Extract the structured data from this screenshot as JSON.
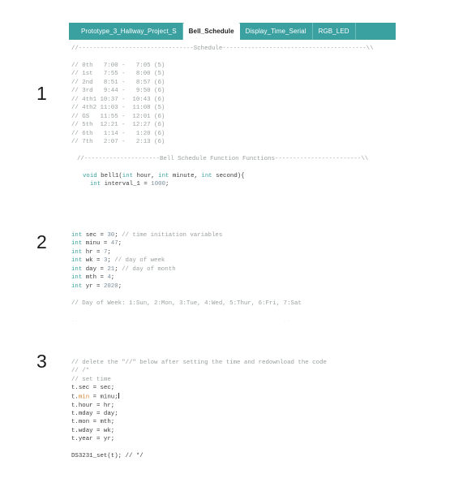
{
  "markers": {
    "one": "1",
    "two": "2",
    "three": "3"
  },
  "colors": {
    "tab_bar_teal": "#3aa0a0",
    "active_tab_bg": "#ffffff",
    "keyword_teal": "#3aa0a0",
    "keyword_orange": "#d4812a",
    "comment_gray": "#9aa0a0",
    "code_text": "#3c3c3c"
  },
  "editor": {
    "tabs": [
      {
        "label": "Prototype_3_Hallway_Project_S",
        "active": false
      },
      {
        "label": "Bell_Schedule",
        "active": true
      },
      {
        "label": "Display_Time_Serial",
        "active": false
      },
      {
        "label": "RGB_LED",
        "active": false
      }
    ]
  },
  "code": {
    "schedule_header": "//--------------------------------Schedule----------------------------------------\\\\",
    "schedule_rows": [
      "// 0th   7:00 -   7:05 (5)",
      "// 1st   7:55 -   8:00 (5)",
      "// 2nd   8:51 -   8:57 (6)",
      "// 3rd   9:44 -   9:50 (6)",
      "// 4th1 10:37 -  10:43 (6)",
      "// 4th2 11:03 -  11:08 (5)",
      "// GS   11:55 -  12:01 (6)",
      "// 5th  12:21 -  12:27 (6)",
      "// 6th   1:14 -   1:20 (6)",
      "// 7th   2:07 -   2:13 (6)"
    ],
    "functions_header": "//---------------------Bell Schedule Function Functions------------------------\\\\",
    "function_signature": {
      "kw_void": "void",
      "name": " bell1(",
      "kw_int_1": "int",
      "arg_1": " hour, ",
      "kw_int_2": "int",
      "arg_2": " minute, ",
      "kw_int_3": "int",
      "arg_3": " second){"
    },
    "function_body": {
      "indent": "  ",
      "kw_int": "int",
      "decl": " interval_1 = ",
      "value": "1000",
      "end": ";"
    },
    "variables": [
      {
        "kw": "int",
        "name": " sec = ",
        "value": "30",
        "end": ";",
        "comment": " // time initiation variables"
      },
      {
        "kw": "int",
        "name": " minu = ",
        "value": "47",
        "end": ";",
        "comment": ""
      },
      {
        "kw": "int",
        "name": " hr = ",
        "value": "7",
        "end": ";",
        "comment": ""
      },
      {
        "kw": "int",
        "name": " wk = ",
        "value": "3",
        "end": ";",
        "comment": " // day of week"
      },
      {
        "kw": "int",
        "name": " day = ",
        "value": "21",
        "end": ";",
        "comment": " // day of month"
      },
      {
        "kw": "int",
        "name": " mth = ",
        "value": "4",
        "end": ";",
        "comment": ""
      },
      {
        "kw": "int",
        "name": " yr = ",
        "value": "2020",
        "end": ";",
        "comment": ""
      }
    ],
    "day_of_week_comment": "// Day of Week: 1:Sun, 2:Mon, 3:Tue, 4:Wed, 5:Thur, 6:Fri, 7:Sat",
    "faint_line": "..                                                         ..",
    "instruction_comment": "// delete the \"//\" below after setting the time and redownload the code",
    "block_open_comment": "// /*",
    "set_time_comment": "// set time",
    "assignments": [
      {
        "obj": "t.",
        "prop": "sec",
        "prop_kw": false,
        "rest": " = sec;",
        "caret": false
      },
      {
        "obj": "t.",
        "prop": "min",
        "prop_kw": true,
        "rest": " = minu;",
        "caret": true
      },
      {
        "obj": "t.",
        "prop": "hour",
        "prop_kw": false,
        "rest": " = hr;",
        "caret": false
      },
      {
        "obj": "t.",
        "prop": "mday",
        "prop_kw": false,
        "rest": " = day;",
        "caret": false
      },
      {
        "obj": "t.",
        "prop": "mon",
        "prop_kw": false,
        "rest": " = mth;",
        "caret": false
      },
      {
        "obj": "t.",
        "prop": "wday",
        "prop_kw": false,
        "rest": " = wk;",
        "caret": false
      },
      {
        "obj": "t.",
        "prop": "year",
        "prop_kw": false,
        "rest": " = yr;",
        "caret": false
      }
    ],
    "final_line": "DS3231_set(t); // */"
  }
}
